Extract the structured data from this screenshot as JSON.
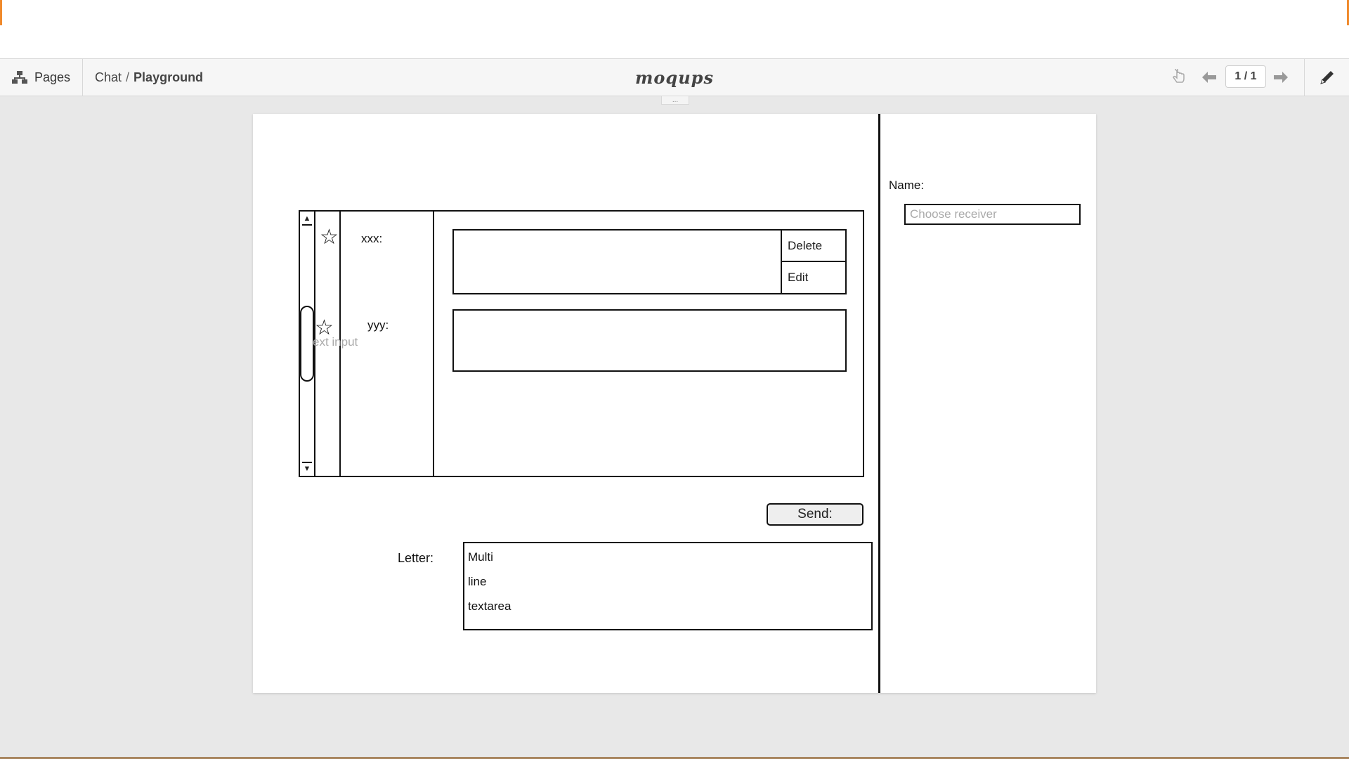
{
  "toolbar": {
    "pages_label": "Pages",
    "breadcrumb_project": "Chat",
    "breadcrumb_separator": "/",
    "breadcrumb_page": "Playground",
    "logo_text": "moqups",
    "page_counter": "1 / 1",
    "icons": [
      "sitemap-icon",
      "hand-pointer-icon",
      "arrow-left-icon",
      "arrow-right-icon",
      "pencil-icon"
    ]
  },
  "collapse_handle": "...",
  "canvas": {
    "messages": [
      {
        "sender": "xxx:",
        "actions": [
          "Delete",
          "Edit"
        ]
      },
      {
        "sender": "yyy:"
      }
    ],
    "ghost_text": "ext input",
    "send_label": "Send:",
    "letter_label": "Letter:",
    "letter_lines": [
      "Multi",
      "line",
      "textarea"
    ],
    "name_label": "Name:",
    "receiver_placeholder": "Choose receiver"
  },
  "colors": {
    "accent": "#f08a2c",
    "canvas_bg": "#ffffff",
    "workspace_bg": "#e8e8e8",
    "toolbar_bg": "#f6f6f6"
  }
}
